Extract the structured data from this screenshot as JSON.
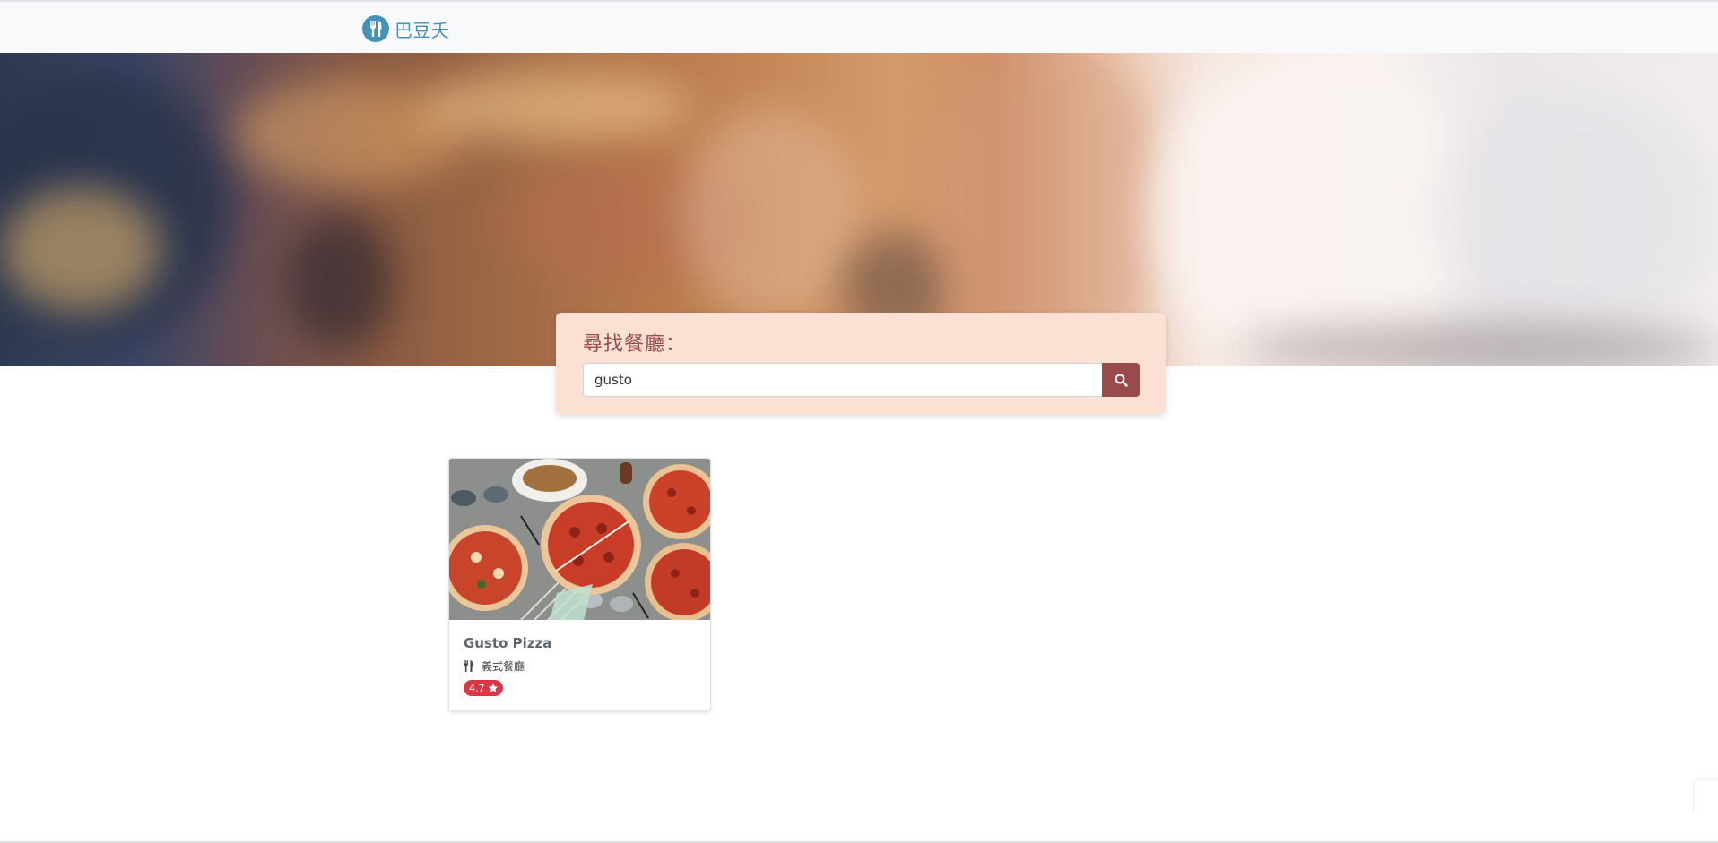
{
  "navbar": {
    "brand_name": "巴豆夭",
    "brand_icon": "utensils-icon",
    "brand_color": "#4592b6"
  },
  "hero": {
    "image": "blurred-restaurant-interior"
  },
  "search": {
    "label": "尋找餐廳：",
    "value": "gusto",
    "button_icon": "search-icon",
    "panel_color": "#fde0d4",
    "button_color": "#984a4d"
  },
  "restaurants": [
    {
      "name": "Gusto Pizza",
      "category": "義式餐廳",
      "category_icon": "utensils-icon",
      "rating": "4.7",
      "rating_icon": "star-icon",
      "image": "pizza-spread-photo",
      "badge_color": "#dc3545"
    }
  ]
}
